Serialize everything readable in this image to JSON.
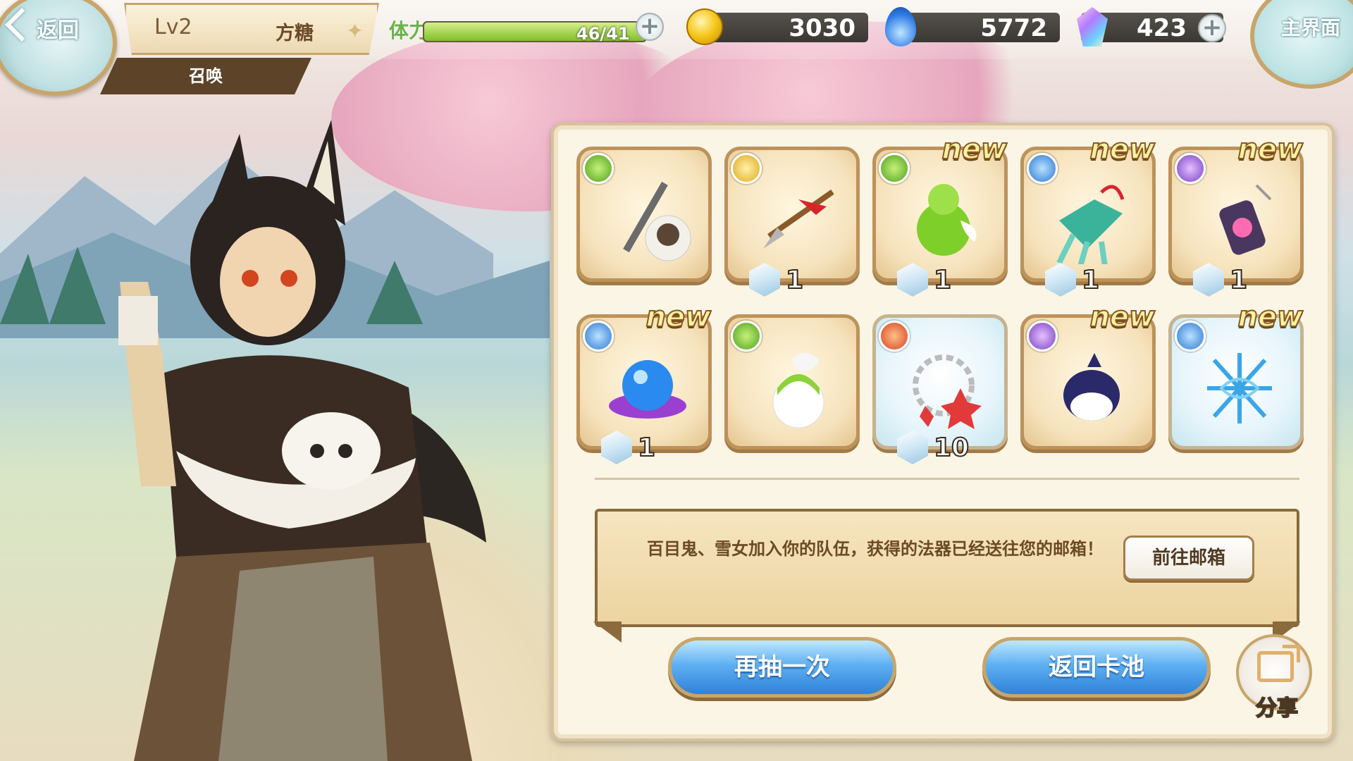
{
  "header": {
    "back_label": "返回",
    "level": "Lv2",
    "player_name": "方糖",
    "sub_title": "召唤",
    "home_label": "主界面"
  },
  "stamina": {
    "label": "体力",
    "text": "46/41",
    "fill_fraction": 1.0
  },
  "currencies": [
    {
      "icon": "gold-coin-icon",
      "value": "3030"
    },
    {
      "icon": "blue-soul-icon",
      "value": "5772"
    },
    {
      "icon": "crystal-gem-icon",
      "value": "423"
    }
  ],
  "rewards": [
    {
      "name": "staff-with-character",
      "element": "green",
      "new": false,
      "new_label": "",
      "qty": ""
    },
    {
      "name": "red-ribbon-spear",
      "element": "gold",
      "new": false,
      "new_label": "",
      "qty": "1"
    },
    {
      "name": "green-gourd",
      "element": "green",
      "new": true,
      "new_label": "new",
      "qty": "1"
    },
    {
      "name": "jade-claw",
      "element": "blue",
      "new": true,
      "new_label": "new",
      "qty": "1"
    },
    {
      "name": "spirit-lantern",
      "element": "purple",
      "new": true,
      "new_label": "new",
      "qty": "1"
    },
    {
      "name": "blue-orb",
      "element": "blue",
      "new": true,
      "new_label": "new",
      "qty": "1"
    },
    {
      "name": "green-haired-character",
      "element": "green",
      "new": false,
      "new_label": "",
      "qty": ""
    },
    {
      "name": "red-star-chain",
      "element": "red",
      "new": false,
      "new_label": "",
      "qty": "10"
    },
    {
      "name": "dark-egg-creature",
      "element": "purple",
      "new": true,
      "new_label": "new",
      "qty": ""
    },
    {
      "name": "ice-web",
      "element": "blue",
      "new": true,
      "new_label": "new",
      "qty": ""
    }
  ],
  "message": {
    "text": "百目鬼、雪女加入你的队伍，获得的法器已经送往您的邮箱！",
    "mail_button": "前往邮箱"
  },
  "buttons": {
    "draw_again": "再抽一次",
    "back_to_pool": "返回卡池",
    "share": "分享"
  },
  "colors": {
    "panel_bg": "#fbf5e6",
    "slot_border": "#bd925a",
    "button_blue": "#2f82d8",
    "stamina_green": "#7fbf2a"
  }
}
